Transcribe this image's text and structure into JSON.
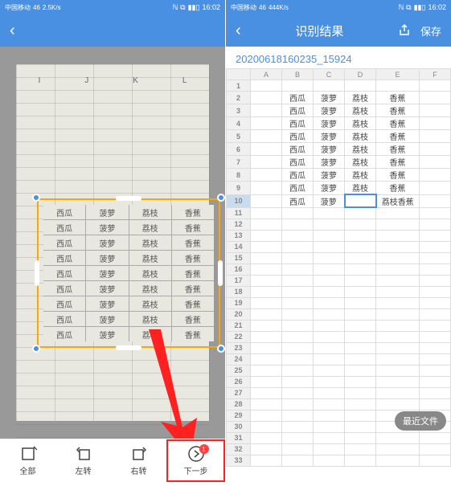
{
  "status": {
    "carrier": "中国移动",
    "time": "16:02",
    "signal": "2.5K/s",
    "net": "46",
    "right_signal": "444K/s"
  },
  "left": {
    "header_letters": [
      "I",
      "J",
      "K",
      "L"
    ],
    "crop_table": [
      [
        "西瓜",
        "菠萝",
        "荔枝",
        "香蕉"
      ],
      [
        "西瓜",
        "菠萝",
        "荔枝",
        "香蕉"
      ],
      [
        "西瓜",
        "菠萝",
        "荔枝",
        "香蕉"
      ],
      [
        "西瓜",
        "菠萝",
        "荔枝",
        "香蕉"
      ],
      [
        "西瓜",
        "菠萝",
        "荔枝",
        "香蕉"
      ],
      [
        "西瓜",
        "菠萝",
        "荔枝",
        "香蕉"
      ],
      [
        "西瓜",
        "菠萝",
        "荔枝",
        "香蕉"
      ],
      [
        "西瓜",
        "菠萝",
        "荔枝",
        "香蕉"
      ],
      [
        "西瓜",
        "菠萝",
        "荔枝",
        "香蕉"
      ]
    ],
    "bottom": {
      "all": "全部",
      "rotl": "左转",
      "rotr": "右转",
      "next": "下一步",
      "badge": "1"
    }
  },
  "right": {
    "title": "识别结果",
    "save": "保存",
    "doc_name": "20200618160235_15924",
    "cols": [
      "A",
      "B",
      "C",
      "D",
      "E",
      "F"
    ],
    "rows": 33,
    "data": {
      "2": {
        "B": "西瓜",
        "C": "菠萝",
        "D": "荔枝",
        "E": "香蕉"
      },
      "3": {
        "B": "西瓜",
        "C": "菠萝",
        "D": "荔枝",
        "E": "香蕉"
      },
      "4": {
        "B": "西瓜",
        "C": "菠萝",
        "D": "荔枝",
        "E": "香蕉"
      },
      "5": {
        "B": "西瓜",
        "C": "菠萝",
        "D": "荔枝",
        "E": "香蕉"
      },
      "6": {
        "B": "西瓜",
        "C": "菠萝",
        "D": "荔枝",
        "E": "香蕉"
      },
      "7": {
        "B": "西瓜",
        "C": "菠萝",
        "D": "荔枝",
        "E": "香蕉"
      },
      "8": {
        "B": "西瓜",
        "C": "菠萝",
        "D": "荔枝",
        "E": "香蕉"
      },
      "9": {
        "B": "西瓜",
        "C": "菠萝",
        "D": "荔枝",
        "E": "香蕉"
      },
      "10": {
        "B": "西瓜",
        "C": "菠萝",
        "E": "荔枝香蕉"
      }
    },
    "selected": {
      "row": 10,
      "col": "D"
    },
    "recent": "最近文件"
  }
}
